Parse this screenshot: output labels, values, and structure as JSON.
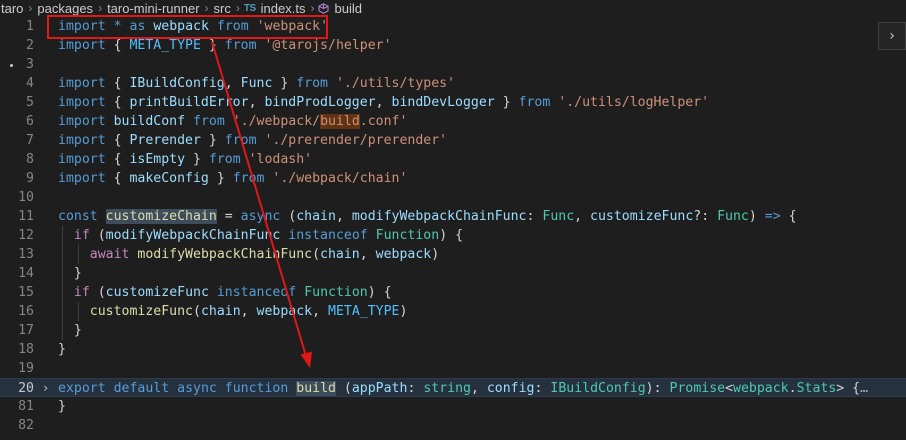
{
  "breadcrumb": {
    "items": [
      "taro",
      "packages",
      "taro-mini-runner",
      "src"
    ],
    "file_badge": "TS",
    "file_name": "index.ts",
    "symbol_name": "build"
  },
  "editor": {
    "lines": [
      {
        "num": "1",
        "tokens": [
          [
            "k",
            "import"
          ],
          [
            "p",
            " "
          ],
          [
            "k",
            "*"
          ],
          [
            "p",
            " "
          ],
          [
            "k",
            "as"
          ],
          [
            "p",
            " "
          ],
          [
            "v",
            "webpack"
          ],
          [
            "p",
            " "
          ],
          [
            "k",
            "from"
          ],
          [
            "p",
            " "
          ],
          [
            "s",
            "'webpack'"
          ]
        ]
      },
      {
        "num": "2",
        "tokens": [
          [
            "k",
            "import"
          ],
          [
            "p",
            " { "
          ],
          [
            "vc",
            "META_TYPE"
          ],
          [
            "p",
            " } "
          ],
          [
            "k",
            "from"
          ],
          [
            "p",
            " "
          ],
          [
            "s",
            "'@tarojs/helper'"
          ]
        ]
      },
      {
        "num": "3",
        "tokens": []
      },
      {
        "num": "4",
        "tokens": [
          [
            "k",
            "import"
          ],
          [
            "p",
            " { "
          ],
          [
            "v",
            "IBuildConfig"
          ],
          [
            "p",
            ", "
          ],
          [
            "v",
            "Func"
          ],
          [
            "p",
            " } "
          ],
          [
            "k",
            "from"
          ],
          [
            "p",
            " "
          ],
          [
            "s",
            "'./utils/types'"
          ]
        ]
      },
      {
        "num": "5",
        "tokens": [
          [
            "k",
            "import"
          ],
          [
            "p",
            " { "
          ],
          [
            "v",
            "printBuildError"
          ],
          [
            "p",
            ", "
          ],
          [
            "v",
            "bindProdLogger"
          ],
          [
            "p",
            ", "
          ],
          [
            "v",
            "bindDevLogger"
          ],
          [
            "p",
            " } "
          ],
          [
            "k",
            "from"
          ],
          [
            "p",
            " "
          ],
          [
            "s",
            "'./utils/logHelper'"
          ]
        ]
      },
      {
        "num": "6",
        "tokens": [
          [
            "k",
            "import"
          ],
          [
            "p",
            " "
          ],
          [
            "v",
            "buildConf"
          ],
          [
            "p",
            " "
          ],
          [
            "k",
            "from"
          ],
          [
            "p",
            " "
          ],
          [
            "s",
            "'./webpack/"
          ],
          [
            "s hs",
            "build"
          ],
          [
            "s",
            ".conf'"
          ]
        ]
      },
      {
        "num": "7",
        "tokens": [
          [
            "k",
            "import"
          ],
          [
            "p",
            " { "
          ],
          [
            "v",
            "Prerender"
          ],
          [
            "p",
            " } "
          ],
          [
            "k",
            "from"
          ],
          [
            "p",
            " "
          ],
          [
            "s",
            "'./prerender/prerender'"
          ]
        ]
      },
      {
        "num": "8",
        "tokens": [
          [
            "k",
            "import"
          ],
          [
            "p",
            " { "
          ],
          [
            "v",
            "isEmpty"
          ],
          [
            "p",
            " } "
          ],
          [
            "k",
            "from"
          ],
          [
            "p",
            " "
          ],
          [
            "s",
            "'lodash'"
          ]
        ]
      },
      {
        "num": "9",
        "tokens": [
          [
            "k",
            "import"
          ],
          [
            "p",
            " { "
          ],
          [
            "v",
            "makeConfig"
          ],
          [
            "p",
            " } "
          ],
          [
            "k",
            "from"
          ],
          [
            "p",
            " "
          ],
          [
            "s",
            "'./webpack/chain'"
          ]
        ]
      },
      {
        "num": "10",
        "tokens": []
      },
      {
        "num": "11",
        "tokens": [
          [
            "k",
            "const"
          ],
          [
            "p",
            " "
          ],
          [
            "f hw",
            "customizeChain"
          ],
          [
            "p",
            " = "
          ],
          [
            "k",
            "async"
          ],
          [
            "p",
            " ("
          ],
          [
            "v",
            "chain"
          ],
          [
            "p",
            ", "
          ],
          [
            "v",
            "modifyWebpackChainFunc"
          ],
          [
            "p",
            ": "
          ],
          [
            "t",
            "Func"
          ],
          [
            "p",
            ", "
          ],
          [
            "v",
            "customizeFunc"
          ],
          [
            "p",
            "?: "
          ],
          [
            "t",
            "Func"
          ],
          [
            "p",
            ") "
          ],
          [
            "k",
            "=>"
          ],
          [
            "p",
            " {"
          ]
        ]
      },
      {
        "num": "12",
        "tokens": [
          [
            "p",
            "  "
          ],
          [
            "kc",
            "if"
          ],
          [
            "p",
            " ("
          ],
          [
            "v",
            "modifyWebpackChainFunc"
          ],
          [
            "p",
            " "
          ],
          [
            "k",
            "instanceof"
          ],
          [
            "p",
            " "
          ],
          [
            "t",
            "Function"
          ],
          [
            "p",
            ") {"
          ]
        ]
      },
      {
        "num": "13",
        "tokens": [
          [
            "p",
            "    "
          ],
          [
            "kc",
            "await"
          ],
          [
            "p",
            " "
          ],
          [
            "f",
            "modifyWebpackChainFunc"
          ],
          [
            "p",
            "("
          ],
          [
            "v",
            "chain"
          ],
          [
            "p",
            ", "
          ],
          [
            "v",
            "webpack"
          ],
          [
            "p",
            ")"
          ]
        ]
      },
      {
        "num": "14",
        "tokens": [
          [
            "p",
            "  }"
          ]
        ]
      },
      {
        "num": "15",
        "tokens": [
          [
            "p",
            "  "
          ],
          [
            "kc",
            "if"
          ],
          [
            "p",
            " ("
          ],
          [
            "v",
            "customizeFunc"
          ],
          [
            "p",
            " "
          ],
          [
            "k",
            "instanceof"
          ],
          [
            "p",
            " "
          ],
          [
            "t",
            "Function"
          ],
          [
            "p",
            ") {"
          ]
        ]
      },
      {
        "num": "16",
        "tokens": [
          [
            "p",
            "    "
          ],
          [
            "f",
            "customizeFunc"
          ],
          [
            "p",
            "("
          ],
          [
            "v",
            "chain"
          ],
          [
            "p",
            ", "
          ],
          [
            "v",
            "webpack"
          ],
          [
            "p",
            ", "
          ],
          [
            "vc",
            "META_TYPE"
          ],
          [
            "p",
            ")"
          ]
        ]
      },
      {
        "num": "17",
        "tokens": [
          [
            "p",
            "  }"
          ]
        ]
      },
      {
        "num": "18",
        "tokens": [
          [
            "p",
            "}"
          ]
        ]
      },
      {
        "num": "19",
        "tokens": []
      },
      {
        "num": "20",
        "folded": true,
        "tokens": [
          [
            "k",
            "export"
          ],
          [
            "p",
            " "
          ],
          [
            "k",
            "default"
          ],
          [
            "p",
            " "
          ],
          [
            "k",
            "async"
          ],
          [
            "p",
            " "
          ],
          [
            "k",
            "function"
          ],
          [
            "p",
            " "
          ],
          [
            "f hw",
            "build"
          ],
          [
            "p",
            " ("
          ],
          [
            "v",
            "appPath"
          ],
          [
            "p",
            ": "
          ],
          [
            "t",
            "string"
          ],
          [
            "p",
            ", "
          ],
          [
            "v",
            "config"
          ],
          [
            "p",
            ": "
          ],
          [
            "t",
            "IBuildConfig"
          ],
          [
            "p",
            "): "
          ],
          [
            "t",
            "Promise"
          ],
          [
            "p",
            "<"
          ],
          [
            "t",
            "webpack"
          ],
          [
            "p",
            "."
          ],
          [
            "t",
            "Stats"
          ],
          [
            "p",
            "> {"
          ],
          [
            "ellipsis",
            "…"
          ]
        ]
      },
      {
        "num": "81",
        "tokens": [
          [
            "p",
            "}"
          ]
        ]
      },
      {
        "num": "82",
        "tokens": []
      }
    ]
  },
  "icons": {
    "fold_arrow": "chevron-right-icon",
    "symbol": "symbol-method-icon",
    "panel_toggle": "chevron-right-icon"
  },
  "colors": {
    "annotation": "#e01818",
    "background": "#1e1e1e"
  }
}
